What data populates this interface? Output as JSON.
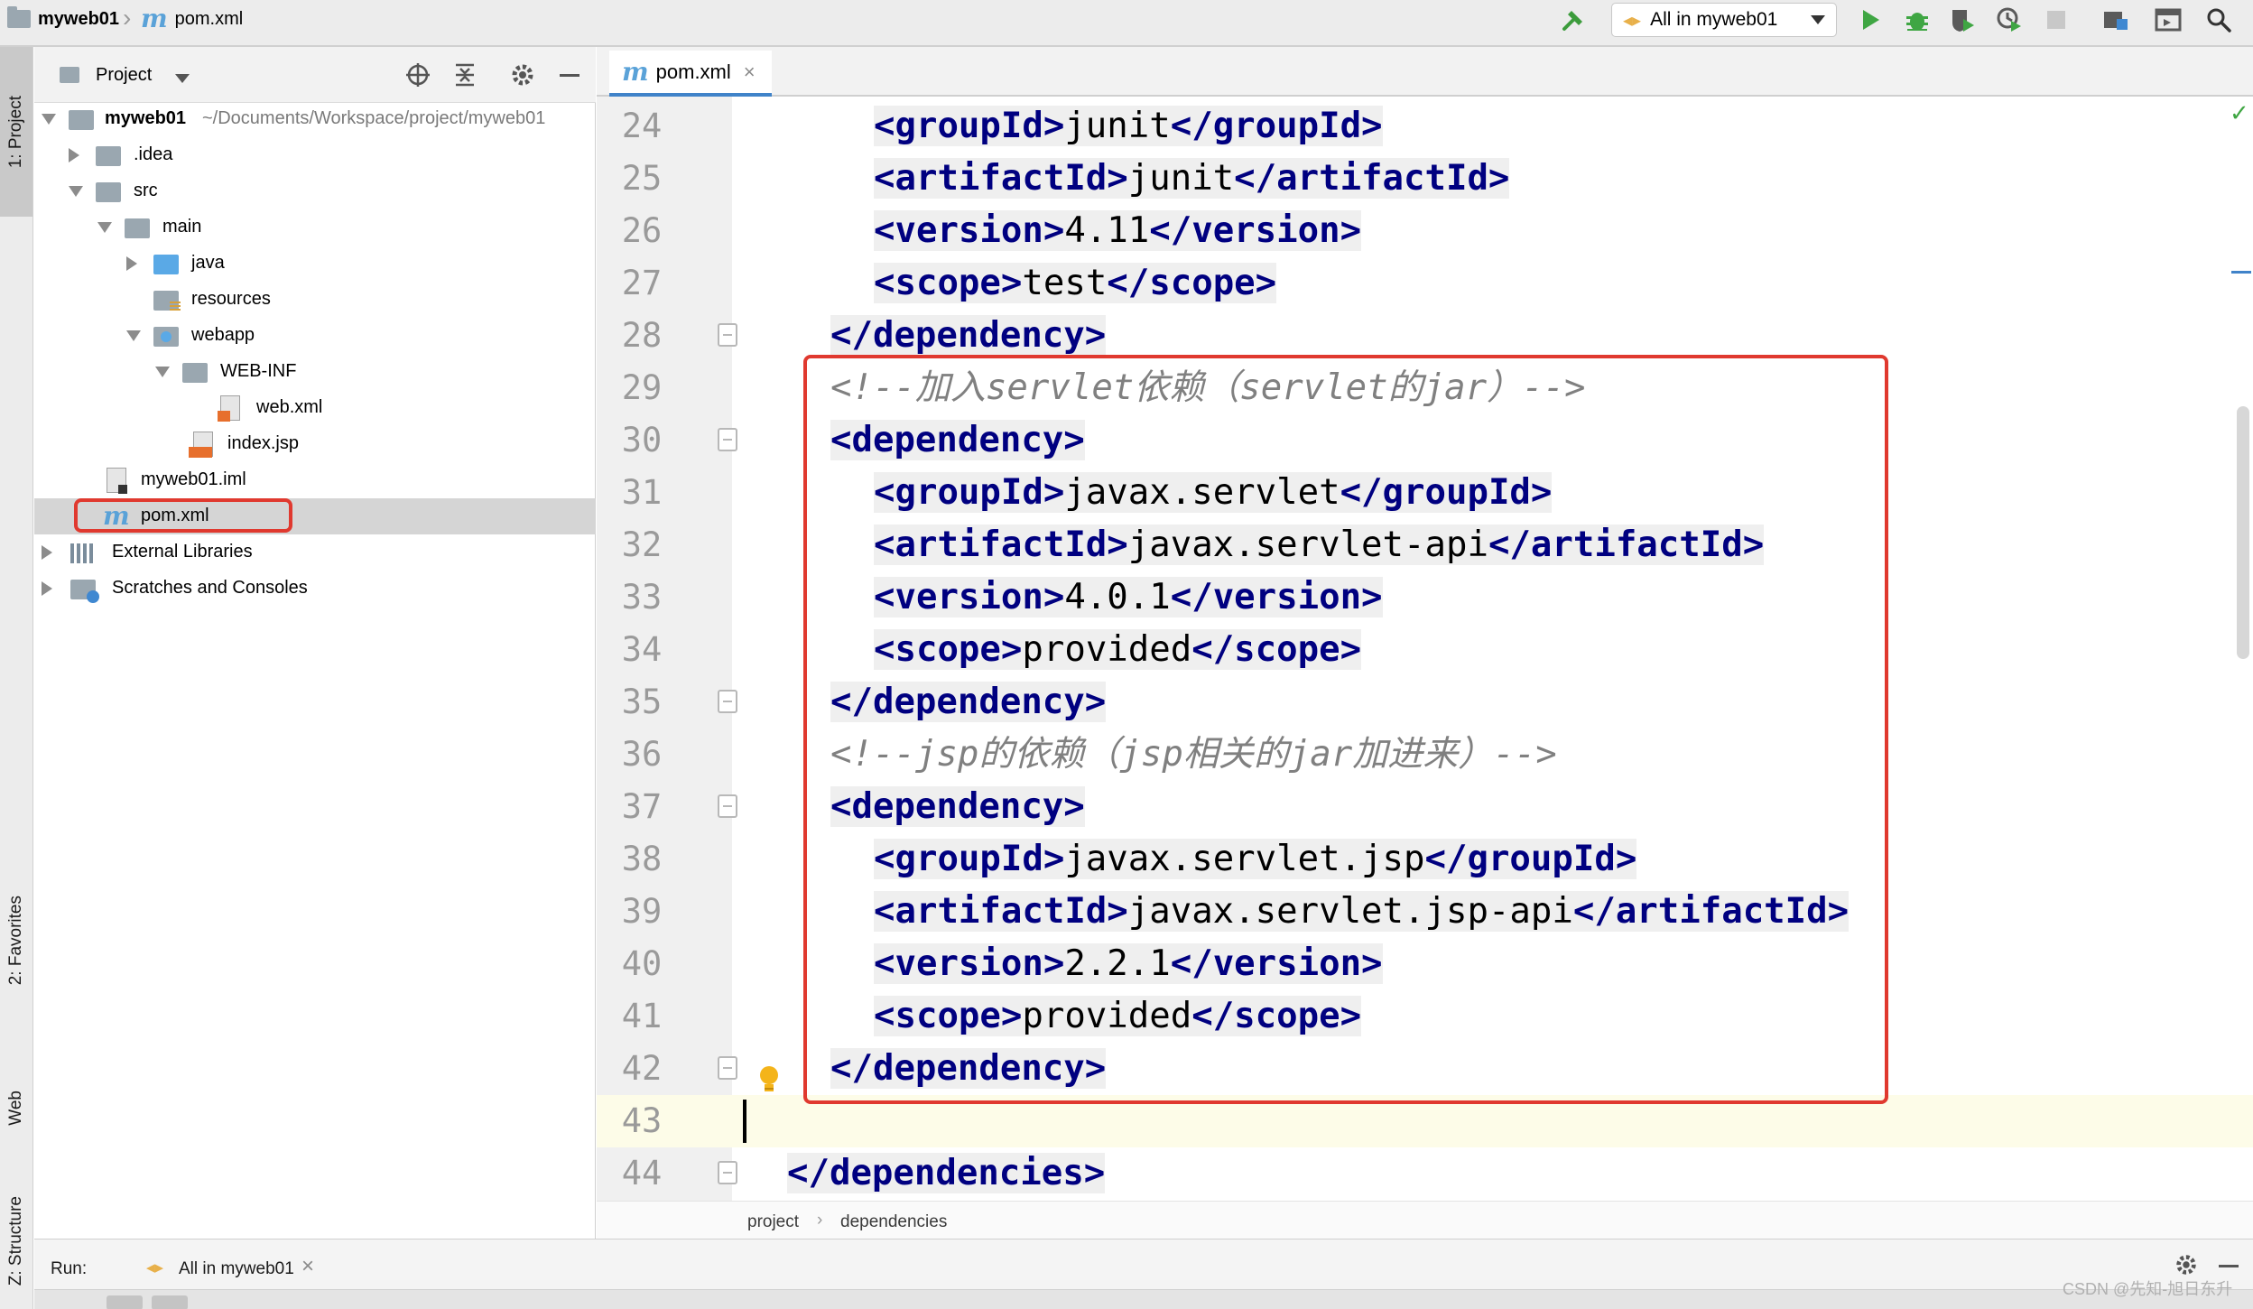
{
  "topbar": {
    "project_name": "myweb01",
    "file_name": "pom.xml",
    "run_config": "All in myweb01"
  },
  "toolwindows": {
    "project": "1: Project",
    "favorites": "2: Favorites",
    "web": "Web",
    "structure": "Z: Structure"
  },
  "project_panel": {
    "title": "Project",
    "tree": [
      {
        "label": "myweb01",
        "path": "~/Documents/Workspace/project/myweb01"
      },
      {
        "label": ".idea"
      },
      {
        "label": "src"
      },
      {
        "label": "main"
      },
      {
        "label": "java"
      },
      {
        "label": "resources"
      },
      {
        "label": "webapp"
      },
      {
        "label": "WEB-INF"
      },
      {
        "label": "web.xml"
      },
      {
        "label": "index.jsp"
      },
      {
        "label": "myweb01.iml"
      },
      {
        "label": "pom.xml"
      },
      {
        "label": "External Libraries"
      },
      {
        "label": "Scratches and Consoles"
      }
    ]
  },
  "editor": {
    "tab_label": "pom.xml",
    "lines": [
      {
        "num": "24",
        "open": "<groupId>",
        "text": "junit",
        "close": "</groupId>"
      },
      {
        "num": "25",
        "open": "<artifactId>",
        "text": "junit",
        "close": "</artifactId>"
      },
      {
        "num": "26",
        "open": "<version>",
        "text": "4.11",
        "close": "</version>"
      },
      {
        "num": "27",
        "open": "<scope>",
        "text": "test",
        "close": "</scope>"
      },
      {
        "num": "28",
        "tag": "</dependency>"
      },
      {
        "num": "29",
        "comment": "<!--加入servlet依赖（servlet的jar）-->"
      },
      {
        "num": "30",
        "tag": "<dependency>"
      },
      {
        "num": "31",
        "open": "<groupId>",
        "text": "javax.servlet",
        "close": "</groupId>"
      },
      {
        "num": "32",
        "open": "<artifactId>",
        "text": "javax.servlet-api",
        "close": "</artifactId>"
      },
      {
        "num": "33",
        "open": "<version>",
        "text": "4.0.1",
        "close": "</version>"
      },
      {
        "num": "34",
        "open": "<scope>",
        "text": "provided",
        "close": "</scope>"
      },
      {
        "num": "35",
        "tag": "</dependency>"
      },
      {
        "num": "36",
        "comment": "<!--jsp的依赖（jsp相关的jar加进来）-->"
      },
      {
        "num": "37",
        "tag": "<dependency>"
      },
      {
        "num": "38",
        "open": "<groupId>",
        "text": "javax.servlet.jsp",
        "close": "</groupId>"
      },
      {
        "num": "39",
        "open": "<artifactId>",
        "text": "javax.servlet.jsp-api",
        "close": "</artifactId>"
      },
      {
        "num": "40",
        "open": "<version>",
        "text": "2.2.1",
        "close": "</version>"
      },
      {
        "num": "41",
        "open": "<scope>",
        "text": "provided",
        "close": "</scope>"
      },
      {
        "num": "42",
        "tag": "</dependency>"
      },
      {
        "num": "43"
      },
      {
        "num": "44",
        "tag": "</dependencies>"
      }
    ],
    "breadcrumb": [
      "project",
      "dependencies"
    ]
  },
  "runbar": {
    "label": "Run:",
    "config": "All in myweb01"
  },
  "watermark": "CSDN @先知-旭日东升",
  "colors": {
    "tag": "#000080",
    "comment": "#808080",
    "highlight_box": "#e0392f",
    "accent": "#4083c9"
  }
}
